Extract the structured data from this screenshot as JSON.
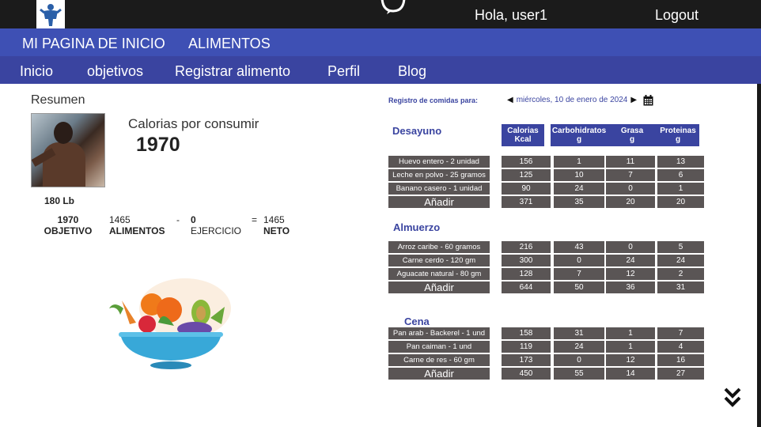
{
  "topbar": {
    "greeting": "Hola, user1",
    "logout": "Logout"
  },
  "nav_primary": [
    "MI PAGINA DE INICIO",
    "ALIMENTOS"
  ],
  "nav_secondary": [
    "Inicio",
    "objetivos",
    "Registrar alimento",
    "Perfil",
    "Blog"
  ],
  "summary": {
    "title": "Resumen",
    "calories_label": "Calorias por consumir",
    "calories_value": "1970",
    "weight": "180 Lb",
    "goal_value": "1970",
    "goal_label": "OBJETIVO",
    "foods_value": "1465",
    "foods_label": "ALIMENTOS",
    "minus": "-",
    "exercise_value": "0",
    "exercise_label": "EJERCICIO",
    "equals": "=",
    "net_value": "1465",
    "net_label": "NETO"
  },
  "log": {
    "label": "Registro de comidas para:",
    "date": "miércoles, 10 de enero de 2024"
  },
  "columns": [
    [
      "Calorias",
      "Kcal"
    ],
    [
      "Carbohidratos",
      "g"
    ],
    [
      "Grasa",
      "g"
    ],
    [
      "Proteinas",
      "g"
    ]
  ],
  "meals": [
    {
      "name": "Desayuno",
      "rows": [
        {
          "food": "Huevo entero - 2 unidad",
          "cal": "156",
          "carb": "1",
          "fat": "11",
          "prot": "13"
        },
        {
          "food": "Leche en polvo - 25 gramos",
          "cal": "125",
          "carb": "10",
          "fat": "7",
          "prot": "6"
        },
        {
          "food": "Banano casero - 1 unidad",
          "cal": "90",
          "carb": "24",
          "fat": "0",
          "prot": "1"
        }
      ],
      "add": "Añadir",
      "totals": {
        "cal": "371",
        "carb": "35",
        "fat": "20",
        "prot": "20"
      }
    },
    {
      "name": "Almuerzo",
      "rows": [
        {
          "food": "Arroz caribe - 60 gramos",
          "cal": "216",
          "carb": "43",
          "fat": "0",
          "prot": "5"
        },
        {
          "food": "Carne cerdo - 120 gm",
          "cal": "300",
          "carb": "0",
          "fat": "24",
          "prot": "24"
        },
        {
          "food": "Aguacate natural - 80 gm",
          "cal": "128",
          "carb": "7",
          "fat": "12",
          "prot": "2"
        }
      ],
      "add": "Añadir",
      "totals": {
        "cal": "644",
        "carb": "50",
        "fat": "36",
        "prot": "31"
      }
    },
    {
      "name": "Cena",
      "rows": [
        {
          "food": "Pan arab - Backerel - 1 und",
          "cal": "158",
          "carb": "31",
          "fat": "1",
          "prot": "7"
        },
        {
          "food": "Pan caiman - 1 und",
          "cal": "119",
          "carb": "24",
          "fat": "1",
          "prot": "4"
        },
        {
          "food": "Carne de res - 60 gm",
          "cal": "173",
          "carb": "0",
          "fat": "12",
          "prot": "16"
        }
      ],
      "add": "Añadir",
      "totals": {
        "cal": "450",
        "carb": "55",
        "fat": "14",
        "prot": "27"
      }
    }
  ],
  "colors": {
    "nav_primary": "#3e50b4",
    "nav_secondary": "#3a44a0",
    "cell_bg": "#5a5555",
    "topbar": "#1b1b1b"
  }
}
